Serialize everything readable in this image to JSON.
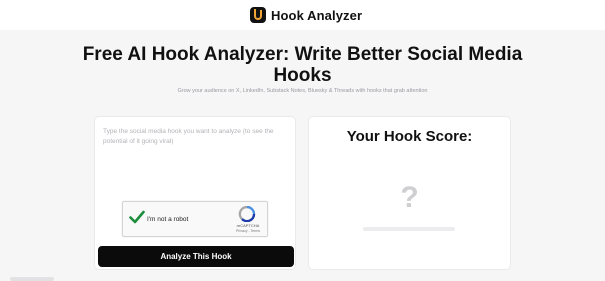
{
  "header": {
    "brand_name": "Hook Analyzer",
    "logo_icon": "brand-logo-icon"
  },
  "hero": {
    "title": "Free AI Hook Analyzer: Write Better Social Media Hooks",
    "subtitle": "Grow your audience on X, LinkedIn, Substack Notes, Bluesky & Threads with hooks that grab attention"
  },
  "analyzer": {
    "input_value": "",
    "input_placeholder": "Type the social media hook you want to analyze (to see the potential of it going viral)",
    "recaptcha": {
      "label": "I'm not a robot",
      "checked": true,
      "brand": "reCAPTCHA",
      "links": "Privacy - Terms"
    },
    "submit_label": "Analyze This Hook"
  },
  "score": {
    "title": "Your Hook Score:",
    "placeholder_glyph": "?",
    "progress": 0
  },
  "colors": {
    "accent": "#f0a534",
    "button": "#0b0b0b",
    "check": "#1e8e3e",
    "background": "#f6f6f7"
  }
}
